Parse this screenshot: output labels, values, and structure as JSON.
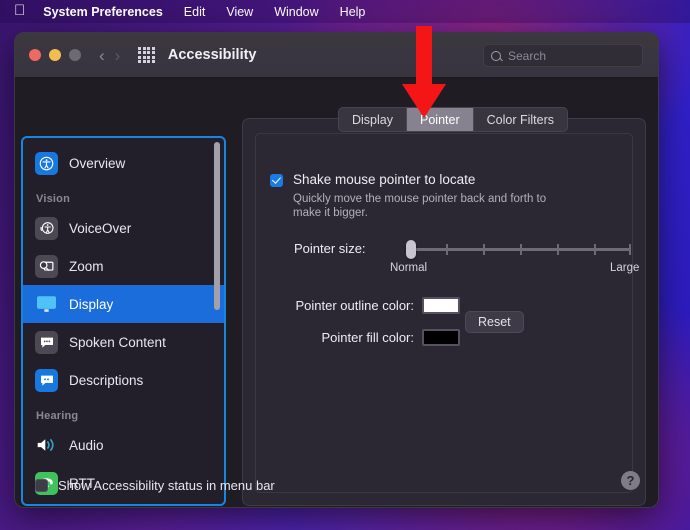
{
  "menubar": {
    "apple_glyph": "",
    "items": [
      {
        "label": "System Preferences",
        "bold": true
      },
      {
        "label": "Edit",
        "bold": false
      },
      {
        "label": "View",
        "bold": false
      },
      {
        "label": "Window",
        "bold": false
      },
      {
        "label": "Help",
        "bold": false
      }
    ]
  },
  "window": {
    "title": "Accessibility",
    "traffic_lights": {
      "close": "#ec6a5f",
      "minimize": "#f4bd4f",
      "zoom": "#6d6a72"
    },
    "nav": {
      "back": "‹",
      "forward": "›"
    },
    "grid_icon": "grid-icon",
    "search": {
      "placeholder": "Search",
      "value": ""
    }
  },
  "sidebar": {
    "items": [
      {
        "label": "Overview",
        "icon": "accessibility-icon",
        "icon_style": "blue",
        "selected": false,
        "type": "item"
      },
      {
        "label": "Vision",
        "type": "header"
      },
      {
        "label": "VoiceOver",
        "icon": "voiceover-icon",
        "icon_style": "grey",
        "selected": false,
        "type": "item"
      },
      {
        "label": "Zoom",
        "icon": "zoom-magnifier-icon",
        "icon_style": "grey",
        "selected": false,
        "type": "item"
      },
      {
        "label": "Display",
        "icon": "display-monitor-icon",
        "icon_style": "blue",
        "selected": true,
        "type": "item"
      },
      {
        "label": "Spoken Content",
        "icon": "speech-bubble-icon",
        "icon_style": "grey",
        "selected": false,
        "type": "item"
      },
      {
        "label": "Descriptions",
        "icon": "descriptions-bubble-icon",
        "icon_style": "blue",
        "selected": false,
        "type": "item"
      },
      {
        "label": "Hearing",
        "type": "header"
      },
      {
        "label": "Audio",
        "icon": "speaker-icon",
        "icon_style": "clear",
        "selected": false,
        "type": "item"
      },
      {
        "label": "RTT",
        "icon": "phone-icon",
        "icon_style": "green",
        "selected": false,
        "type": "item"
      }
    ],
    "selection_color": "#1b6ddb",
    "focus_ring_color": "#1785e2"
  },
  "main": {
    "tabs": [
      {
        "label": "Display",
        "active": false
      },
      {
        "label": "Pointer",
        "active": true
      },
      {
        "label": "Color Filters",
        "active": false
      }
    ],
    "shake_checkbox": {
      "checked": true,
      "title": "Shake mouse pointer to locate",
      "description": "Quickly move the mouse pointer back and forth to make it bigger."
    },
    "pointer_size": {
      "label": "Pointer size:",
      "min_label": "Normal",
      "max_label": "Large",
      "value": 0,
      "ticks": 7
    },
    "outline_color": {
      "label": "Pointer outline color:",
      "value": "#ffffff"
    },
    "fill_color": {
      "label": "Pointer fill color:",
      "value": "#000000"
    },
    "reset_button": "Reset"
  },
  "bottom": {
    "status_checkbox": {
      "checked": false,
      "label": "Show Accessibility status in menu bar"
    },
    "help_button": "?"
  },
  "annotation": {
    "arrow": {
      "color": "#f41616",
      "direction": "down",
      "target": "Pointer tab"
    }
  }
}
